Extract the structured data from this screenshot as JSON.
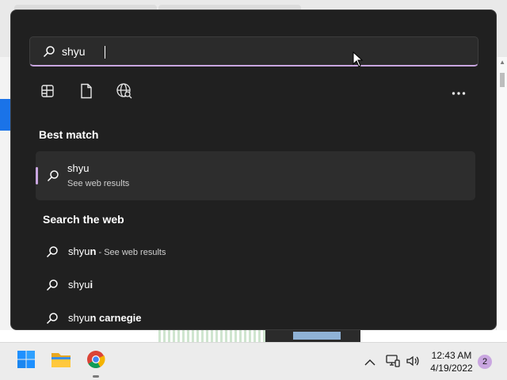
{
  "search": {
    "query": "shyu"
  },
  "filters": [
    {
      "icon": "apps-icon"
    },
    {
      "icon": "documents-icon"
    },
    {
      "icon": "web-icon"
    }
  ],
  "more_icon": "more-options-icon",
  "best_match": {
    "heading": "Best match",
    "title": "shyu",
    "subtitle": "See web results"
  },
  "web": {
    "heading": "Search the web",
    "items": [
      {
        "prefix": "shyu",
        "bold": "n",
        "suffix": " - See web results"
      },
      {
        "prefix": "shyu",
        "bold": "i",
        "suffix": ""
      },
      {
        "prefix": "shyu",
        "bold": "n carnegie",
        "suffix": ""
      }
    ]
  },
  "taskbar": {
    "apps": [
      "windows-start-icon",
      "file-explorer-icon",
      "chrome-icon"
    ],
    "tray": [
      "chevron-up-icon",
      "network-icon",
      "volume-icon"
    ],
    "time": "12:43 AM",
    "date": "4/19/2022",
    "notification_count": "2"
  },
  "colors": {
    "accent": "#c9a6e0",
    "flyout_bg": "#202020",
    "selected_bg": "#2d2d2d"
  }
}
